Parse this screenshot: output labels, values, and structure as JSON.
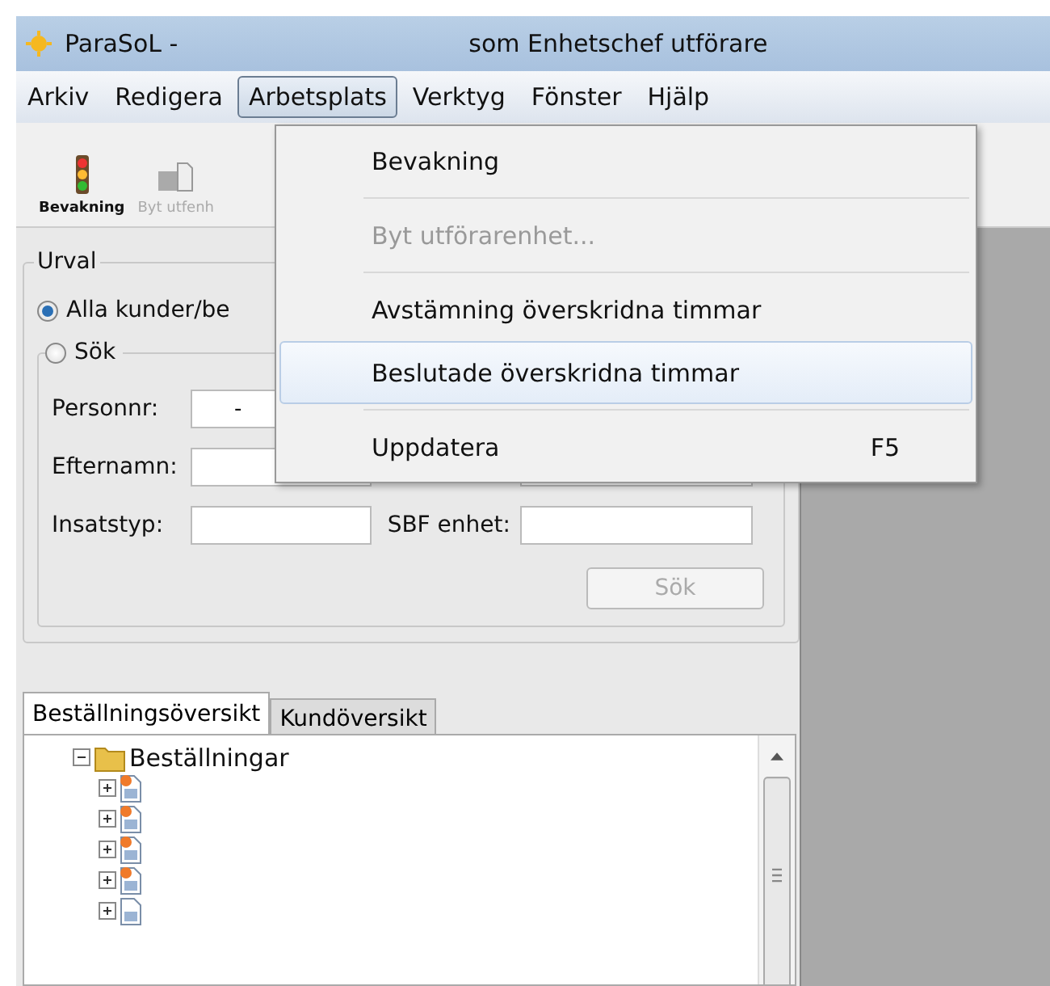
{
  "window": {
    "title_left": "ParaSoL -",
    "title_right": "som Enhetschef utförare"
  },
  "menubar": [
    {
      "label": "Arkiv",
      "selected": false
    },
    {
      "label": "Redigera",
      "selected": false
    },
    {
      "label": "Arbetsplats",
      "selected": true
    },
    {
      "label": "Verktyg",
      "selected": false
    },
    {
      "label": "Fönster",
      "selected": false
    },
    {
      "label": "Hjälp",
      "selected": false
    }
  ],
  "toolbar": [
    {
      "label": "Bevakning",
      "kind": "traffic_light",
      "disabled": false
    },
    {
      "label": "Byt utfenh",
      "kind": "swap",
      "disabled": true
    }
  ],
  "menu": [
    {
      "label": "Bevakning",
      "disabled": false,
      "selected": false
    },
    {
      "kind": "separator"
    },
    {
      "label": "Byt utförarenhet...",
      "disabled": true,
      "selected": false
    },
    {
      "kind": "separator"
    },
    {
      "label": "Avstämning överskridna timmar",
      "disabled": false,
      "selected": false
    },
    {
      "label": "Beslutade överskridna timmar",
      "disabled": false,
      "selected": true
    },
    {
      "kind": "separator"
    },
    {
      "label": "Uppdatera",
      "shortcut": "F5",
      "disabled": false,
      "selected": false
    }
  ],
  "urval": {
    "title": "Urval",
    "radios": [
      {
        "label": "Alla kunder/be",
        "selected": true
      },
      {
        "label": "Sök",
        "selected": false
      }
    ],
    "fields": [
      {
        "label": "Personnr:",
        "value": "-"
      },
      {
        "label": "Efternamn:"
      },
      {
        "label": "Insatstyp:",
        "right_label": "SBF enhet:"
      }
    ],
    "search_button": {
      "label": "Sök",
      "disabled": true
    }
  },
  "tabs": [
    {
      "label": "Beställningsöversikt",
      "selected": true
    },
    {
      "label": "Kundöversikt",
      "selected": false
    }
  ],
  "tree": [
    {
      "label": "Beställningar",
      "expanded": true,
      "children": [
        {
          "kind": "flagged",
          "expanded": false
        },
        {
          "kind": "flagged",
          "expanded": false
        },
        {
          "kind": "flagged",
          "expanded": false
        },
        {
          "kind": "flagged",
          "expanded": false
        },
        {
          "kind": "plain",
          "expanded": false
        }
      ]
    }
  ]
}
